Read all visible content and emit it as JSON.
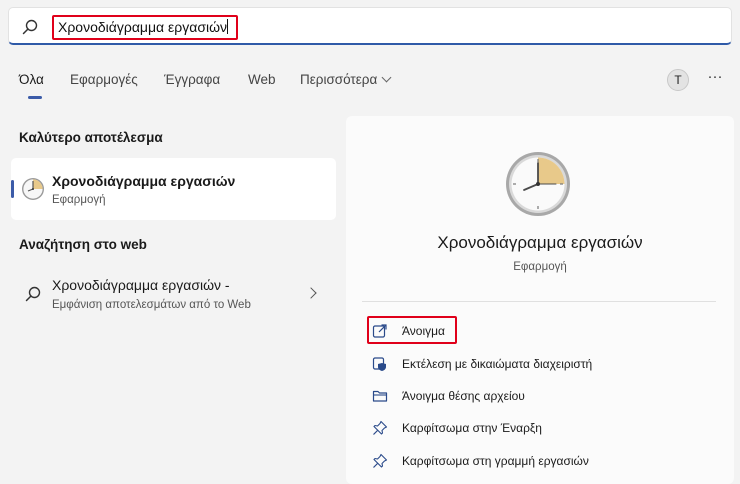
{
  "search": {
    "query": "Χρονοδιάγραμμα εργασιών"
  },
  "tabs": [
    {
      "label": "Όλα"
    },
    {
      "label": "Εφαρμογές"
    },
    {
      "label": "Έγγραφα"
    },
    {
      "label": "Web"
    },
    {
      "label": "Περισσότερα"
    }
  ],
  "profile": {
    "initial": "T",
    "more": "···"
  },
  "best_match": {
    "heading": "Καλύτερο αποτέλεσμα",
    "title": "Χρονοδιάγραμμα εργασιών",
    "subtitle": "Εφαρμογή"
  },
  "web_search": {
    "heading": "Αναζήτηση στο web",
    "title": "Χρονοδιάγραμμα εργασιών -",
    "subtitle": "Εμφάνιση αποτελεσμάτων από το Web"
  },
  "details": {
    "app_name": "Χρονοδιάγραμμα εργασιών",
    "app_type": "Εφαρμογή",
    "actions": [
      {
        "label": "Άνοιγμα",
        "icon": "open-icon"
      },
      {
        "label": "Εκτέλεση με δικαιώματα διαχειριστή",
        "icon": "shield-icon"
      },
      {
        "label": "Άνοιγμα θέσης αρχείου",
        "icon": "folder-icon"
      },
      {
        "label": "Καρφίτσωμα στην Έναρξη",
        "icon": "pin-icon"
      },
      {
        "label": "Καρφίτσωμα στη γραμμή εργασιών",
        "icon": "pin-icon"
      }
    ]
  },
  "colors": {
    "accent": "#3b5ba8",
    "highlight": "#e0001a",
    "clock_sector": "#e8c98a"
  }
}
